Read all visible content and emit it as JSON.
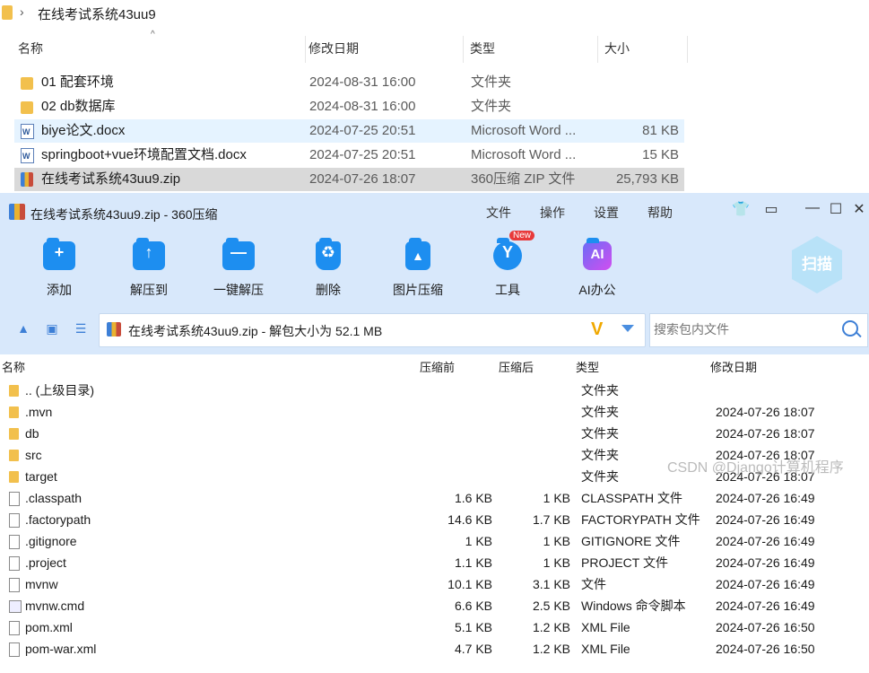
{
  "explorer": {
    "breadcrumb": "在线考试系统43uu9",
    "headers": {
      "name": "名称",
      "modified": "修改日期",
      "type": "类型",
      "size": "大小"
    },
    "rows": [
      {
        "name": "01 配套环境",
        "date": "2024-08-31 16:00",
        "type": "文件夹",
        "size": "",
        "icon": "folder-icon"
      },
      {
        "name": "02 db数据库",
        "date": "2024-08-31 16:00",
        "type": "文件夹",
        "size": "",
        "icon": "folder-icon"
      },
      {
        "name": "biye论文.docx",
        "date": "2024-07-25 20:51",
        "type": "Microsoft Word ...",
        "size": "81 KB",
        "icon": "word-document-icon"
      },
      {
        "name": "springboot+vue环境配置文档.docx",
        "date": "2024-07-25 20:51",
        "type": "Microsoft Word ...",
        "size": "15 KB",
        "icon": "word-document-icon"
      },
      {
        "name": "在线考试系统43uu9.zip",
        "date": "2024-07-26 18:07",
        "type": "360压缩 ZIP 文件",
        "size": "25,793 KB",
        "icon": "zip-archive-icon"
      }
    ]
  },
  "window": {
    "title": "在线考试系统43uu9.zip - 360压缩",
    "menu": [
      "文件",
      "操作",
      "设置",
      "帮助"
    ],
    "toolbar": [
      {
        "label": "添加",
        "glyph": "+"
      },
      {
        "label": "解压到",
        "glyph": "↑"
      },
      {
        "label": "一键解压",
        "glyph": "—"
      },
      {
        "label": "删除",
        "glyph": "♻"
      },
      {
        "label": "图片压缩",
        "glyph": "▲"
      },
      {
        "label": "工具",
        "glyph": "Y"
      },
      {
        "label": "AI办公",
        "glyph": "AI"
      }
    ],
    "new_badge": "New",
    "scan_label": "扫描",
    "path_text": "在线考试系统43uu9.zip - 解包大小为 52.1 MB",
    "search_placeholder": "搜索包内文件",
    "columns": {
      "name": "名称",
      "compressed_before": "压缩前",
      "compressed_after": "压缩后",
      "type": "类型",
      "modified": "修改日期"
    },
    "files": [
      {
        "name": ".. (上级目录)",
        "before": "",
        "after": "",
        "type": "文件夹",
        "date": "",
        "icon": "folder-icon"
      },
      {
        "name": ".mvn",
        "before": "",
        "after": "",
        "type": "文件夹",
        "date": "2024-07-26 18:07",
        "icon": "folder-icon"
      },
      {
        "name": "db",
        "before": "",
        "after": "",
        "type": "文件夹",
        "date": "2024-07-26 18:07",
        "icon": "folder-icon"
      },
      {
        "name": "src",
        "before": "",
        "after": "",
        "type": "文件夹",
        "date": "2024-07-26 18:07",
        "icon": "folder-icon"
      },
      {
        "name": "target",
        "before": "",
        "after": "",
        "type": "文件夹",
        "date": "2024-07-26 18:07",
        "icon": "folder-icon"
      },
      {
        "name": ".classpath",
        "before": "1.6 KB",
        "after": "1 KB",
        "type": "CLASSPATH 文件",
        "date": "2024-07-26 16:49",
        "icon": "file-icon"
      },
      {
        "name": ".factorypath",
        "before": "14.6 KB",
        "after": "1.7 KB",
        "type": "FACTORYPATH 文件",
        "date": "2024-07-26 16:49",
        "icon": "file-icon"
      },
      {
        "name": ".gitignore",
        "before": "1 KB",
        "after": "1 KB",
        "type": "GITIGNORE 文件",
        "date": "2024-07-26 16:49",
        "icon": "file-icon"
      },
      {
        "name": ".project",
        "before": "1.1 KB",
        "after": "1 KB",
        "type": "PROJECT 文件",
        "date": "2024-07-26 16:49",
        "icon": "file-icon"
      },
      {
        "name": "mvnw",
        "before": "10.1 KB",
        "after": "3.1 KB",
        "type": "文件",
        "date": "2024-07-26 16:49",
        "icon": "file-icon"
      },
      {
        "name": "mvnw.cmd",
        "before": "6.6 KB",
        "after": "2.5 KB",
        "type": "Windows 命令脚本",
        "date": "2024-07-26 16:49",
        "icon": "script-icon"
      },
      {
        "name": "pom.xml",
        "before": "5.1 KB",
        "after": "1.2 KB",
        "type": "XML File",
        "date": "2024-07-26 16:50",
        "icon": "file-icon"
      },
      {
        "name": "pom-war.xml",
        "before": "4.7 KB",
        "after": "1.2 KB",
        "type": "XML File",
        "date": "2024-07-26 16:50",
        "icon": "file-icon"
      }
    ]
  },
  "watermark": "CSDN @Django计算机程序"
}
